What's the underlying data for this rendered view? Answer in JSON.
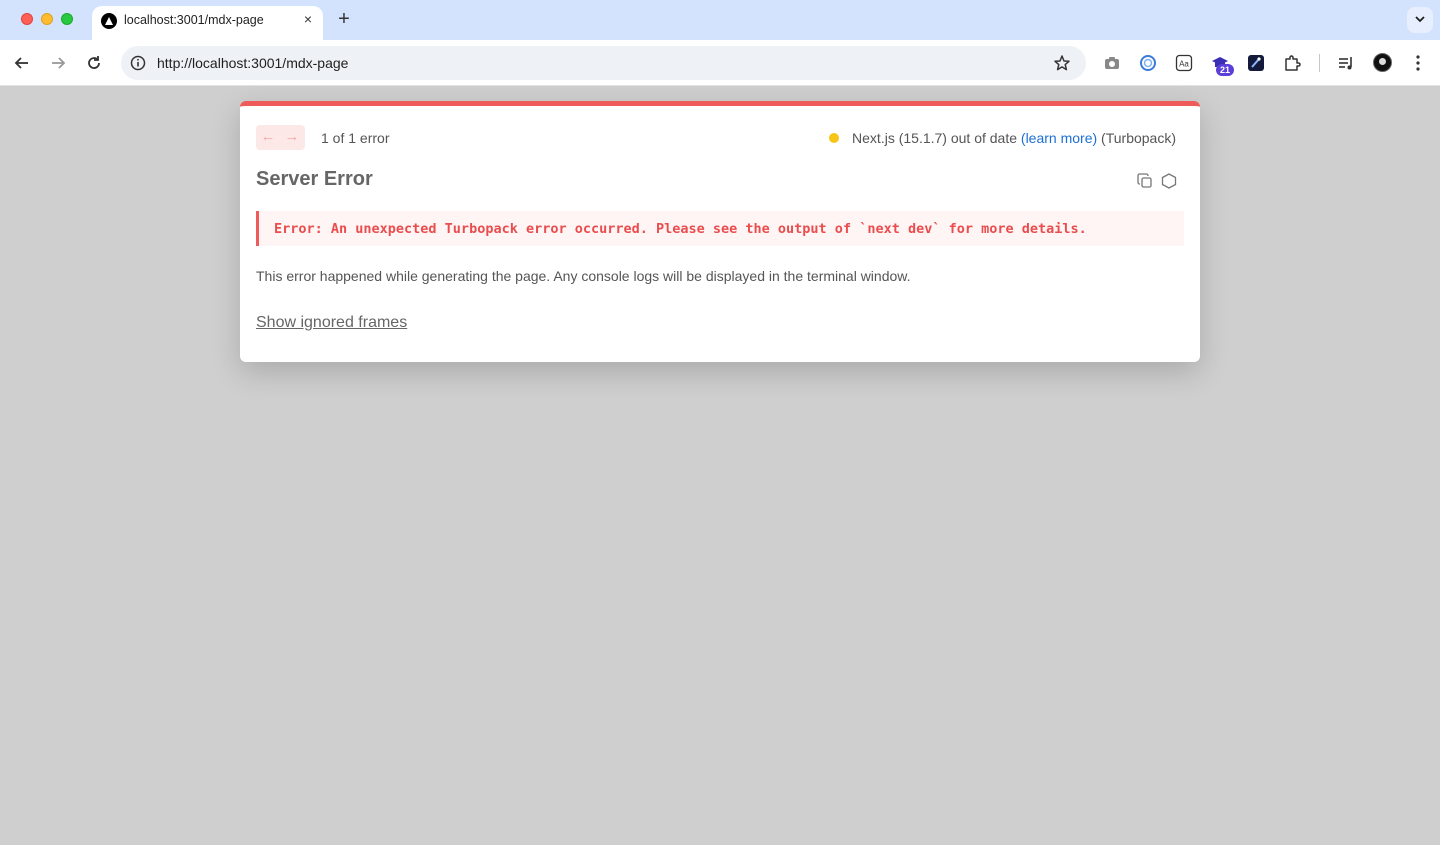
{
  "browser": {
    "tab": {
      "title": "localhost:3001/mdx-page",
      "favicon": "nextjs-triangle-icon",
      "close_label": "×"
    },
    "new_tab_label": "+",
    "url": "http://localhost:3001/mdx-page",
    "extensions": [
      "camera-icon",
      "circle-extension-icon",
      "translate-icon",
      "graduation-cap-extension-icon",
      "rocket-extension-icon",
      "puzzle-extensions-icon",
      "media-queue-icon"
    ],
    "extension_badge": "21",
    "accent_color": "#d3e3fd"
  },
  "dialog": {
    "pager_prev": "←",
    "pager_next": "→",
    "error_count": "1 of 1 error",
    "version_text": "Next.js (15.1.7) out of date",
    "version_link": "(learn more)",
    "version_suffix": "(Turbopack)",
    "status_color": "#f5c518",
    "title": "Server Error",
    "message": "Error: An unexpected Turbopack error occurred. Please see the output of `next dev` for more details.",
    "description": "This error happened while generating the page. Any console logs will be displayed in the terminal window.",
    "show_ignored": "Show ignored frames",
    "error_color": "#ef5b5b"
  }
}
